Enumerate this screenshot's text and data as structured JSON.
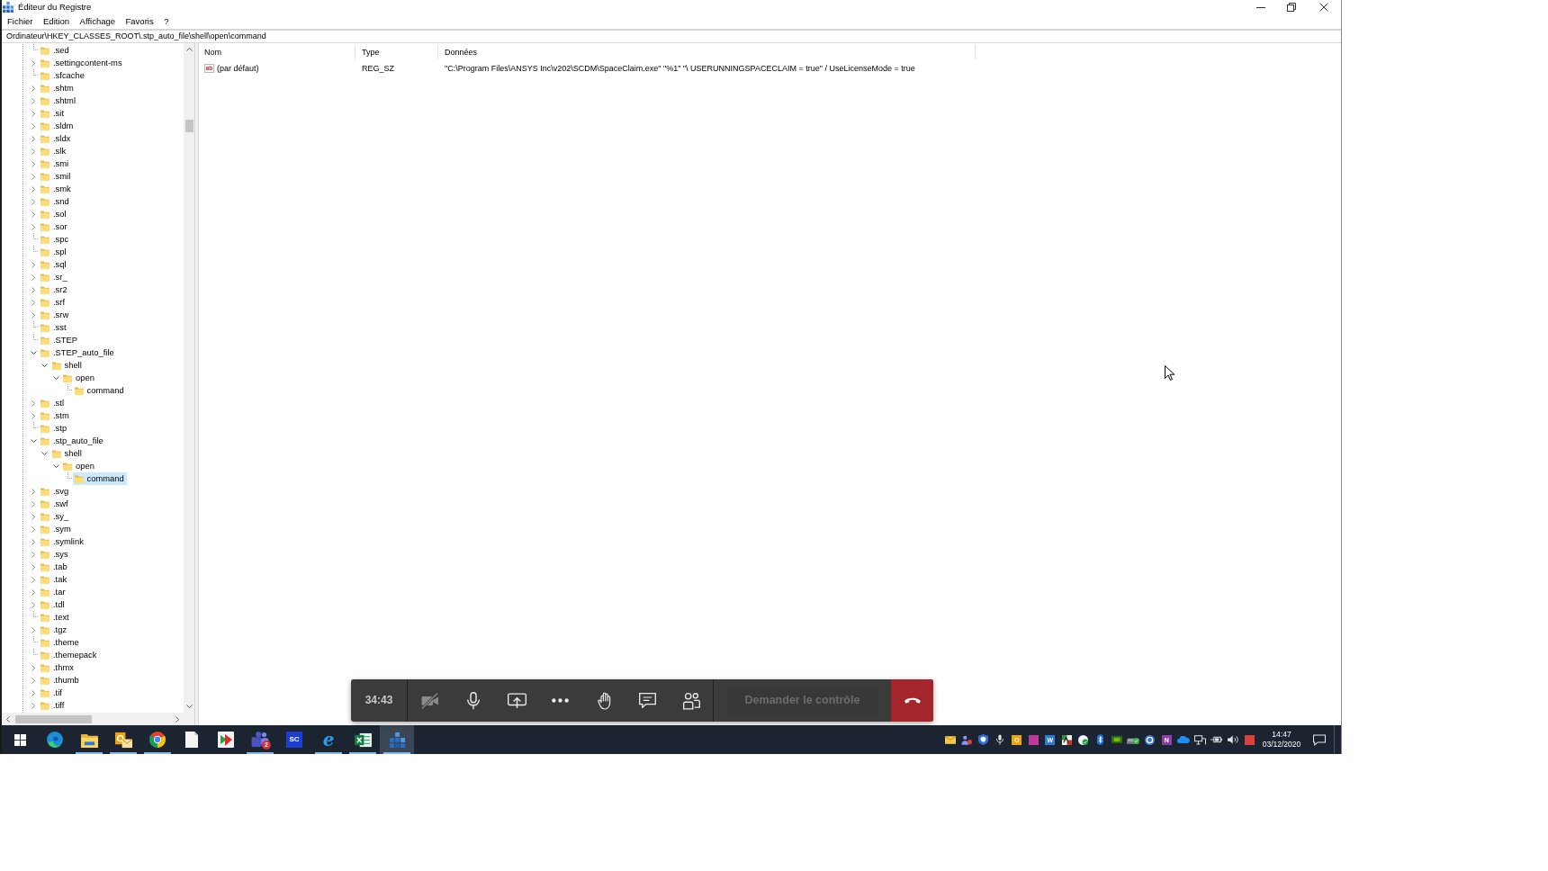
{
  "window": {
    "title": "Éditeur du Registre"
  },
  "menu": [
    "Fichier",
    "Edition",
    "Affichage",
    "Favoris",
    "?"
  ],
  "address_bar": {
    "value": "Ordinateur\\HKEY_CLASSES_ROOT\\.stp_auto_file\\shell\\open\\command"
  },
  "tree": {
    "items": [
      {
        "label": ".sed",
        "kind": "leaf",
        "expanded": false,
        "selected": false
      },
      {
        "label": ".settingcontent-ms",
        "kind": "branch",
        "expanded": false,
        "selected": false
      },
      {
        "label": ".sfcache",
        "kind": "leaf",
        "expanded": false,
        "selected": false
      },
      {
        "label": ".shtm",
        "kind": "branch",
        "expanded": false,
        "selected": false
      },
      {
        "label": ".shtml",
        "kind": "branch",
        "expanded": false,
        "selected": false
      },
      {
        "label": ".sit",
        "kind": "branch",
        "expanded": false,
        "selected": false
      },
      {
        "label": ".sldm",
        "kind": "branch",
        "expanded": false,
        "selected": false
      },
      {
        "label": ".sldx",
        "kind": "branch",
        "expanded": false,
        "selected": false
      },
      {
        "label": ".slk",
        "kind": "branch",
        "expanded": false,
        "selected": false
      },
      {
        "label": ".smi",
        "kind": "branch",
        "expanded": false,
        "selected": false
      },
      {
        "label": ".smil",
        "kind": "branch",
        "expanded": false,
        "selected": false
      },
      {
        "label": ".smk",
        "kind": "branch",
        "expanded": false,
        "selected": false
      },
      {
        "label": ".snd",
        "kind": "branch",
        "expanded": false,
        "selected": false
      },
      {
        "label": ".sol",
        "kind": "branch",
        "expanded": false,
        "selected": false
      },
      {
        "label": ".sor",
        "kind": "branch",
        "expanded": false,
        "selected": false
      },
      {
        "label": ".spc",
        "kind": "leaf",
        "expanded": false,
        "selected": false
      },
      {
        "label": ".spl",
        "kind": "leaf",
        "expanded": false,
        "selected": false
      },
      {
        "label": ".sql",
        "kind": "branch",
        "expanded": false,
        "selected": false
      },
      {
        "label": ".sr_",
        "kind": "branch",
        "expanded": false,
        "selected": false
      },
      {
        "label": ".sr2",
        "kind": "branch",
        "expanded": false,
        "selected": false
      },
      {
        "label": ".srf",
        "kind": "branch",
        "expanded": false,
        "selected": false
      },
      {
        "label": ".srw",
        "kind": "branch",
        "expanded": false,
        "selected": false
      },
      {
        "label": ".sst",
        "kind": "leaf",
        "expanded": false,
        "selected": false
      },
      {
        "label": ".STEP",
        "kind": "leaf",
        "expanded": false,
        "selected": false
      },
      {
        "label": ".STEP_auto_file",
        "kind": "branch",
        "expanded": true,
        "selected": false,
        "children": [
          {
            "label": "shell",
            "kind": "branch",
            "expanded": true,
            "selected": false,
            "children": [
              {
                "label": "open",
                "kind": "branch",
                "expanded": true,
                "selected": false,
                "children": [
                  {
                    "label": "command",
                    "kind": "leaf",
                    "expanded": false,
                    "selected": false
                  }
                ]
              }
            ]
          }
        ]
      },
      {
        "label": ".stl",
        "kind": "branch",
        "expanded": false,
        "selected": false
      },
      {
        "label": ".stm",
        "kind": "branch",
        "expanded": false,
        "selected": false
      },
      {
        "label": ".stp",
        "kind": "leaf",
        "expanded": false,
        "selected": false
      },
      {
        "label": ".stp_auto_file",
        "kind": "branch",
        "expanded": true,
        "selected": false,
        "children": [
          {
            "label": "shell",
            "kind": "branch",
            "expanded": true,
            "selected": false,
            "children": [
              {
                "label": "open",
                "kind": "branch",
                "expanded": true,
                "selected": false,
                "children": [
                  {
                    "label": "command",
                    "kind": "leaf",
                    "expanded": false,
                    "selected": true
                  }
                ]
              }
            ]
          }
        ]
      },
      {
        "label": ".svg",
        "kind": "branch",
        "expanded": false,
        "selected": false
      },
      {
        "label": ".swf",
        "kind": "branch",
        "expanded": false,
        "selected": false
      },
      {
        "label": ".sy_",
        "kind": "branch",
        "expanded": false,
        "selected": false
      },
      {
        "label": ".sym",
        "kind": "branch",
        "expanded": false,
        "selected": false
      },
      {
        "label": ".symlink",
        "kind": "branch",
        "expanded": false,
        "selected": false
      },
      {
        "label": ".sys",
        "kind": "branch",
        "expanded": false,
        "selected": false
      },
      {
        "label": ".tab",
        "kind": "branch",
        "expanded": false,
        "selected": false
      },
      {
        "label": ".tak",
        "kind": "branch",
        "expanded": false,
        "selected": false
      },
      {
        "label": ".tar",
        "kind": "branch",
        "expanded": false,
        "selected": false
      },
      {
        "label": ".tdl",
        "kind": "branch",
        "expanded": false,
        "selected": false
      },
      {
        "label": ".text",
        "kind": "leaf",
        "expanded": false,
        "selected": false
      },
      {
        "label": ".tgz",
        "kind": "branch",
        "expanded": false,
        "selected": false
      },
      {
        "label": ".theme",
        "kind": "leaf",
        "expanded": false,
        "selected": false
      },
      {
        "label": ".themepack",
        "kind": "leaf",
        "expanded": false,
        "selected": false
      },
      {
        "label": ".thmx",
        "kind": "branch",
        "expanded": false,
        "selected": false
      },
      {
        "label": ".thumb",
        "kind": "branch",
        "expanded": false,
        "selected": false
      },
      {
        "label": ".tif",
        "kind": "branch",
        "expanded": false,
        "selected": false
      },
      {
        "label": ".tiff",
        "kind": "branch",
        "expanded": false,
        "selected": false
      }
    ]
  },
  "values": {
    "columns": [
      "Nom",
      "Type",
      "Données"
    ],
    "rows": [
      {
        "icon_text": "ab",
        "name": "(par défaut)",
        "type": "REG_SZ",
        "data": "\"C:\\Program Files\\ANSYS Inc\\v202\\SCDM\\SpaceClaim.exe\" \"%1\" \"\\ USERUNNINGSPACECLAIM = true\" / UseLicenseMode = true"
      }
    ]
  },
  "call_bar": {
    "timer": "34:43",
    "camera_on": false,
    "mic_on": true,
    "request_control": {
      "label": "Demander le contrôle",
      "disabled": true
    }
  },
  "taskbar": {
    "apps": [
      {
        "kind": "swirl",
        "running": false,
        "selected": false
      },
      {
        "kind": "folder",
        "running": true,
        "selected": false
      },
      {
        "kind": "mail",
        "running": true,
        "selected": false
      },
      {
        "kind": "wheel",
        "running": true,
        "selected": false
      },
      {
        "kind": "page",
        "running": false,
        "selected": false
      },
      {
        "kind": "slide",
        "running": false,
        "selected": false
      },
      {
        "kind": "people",
        "badge": "2",
        "running": true,
        "selected": false
      },
      {
        "kind": "tile",
        "label": "SC",
        "running": false,
        "selected": false
      },
      {
        "kind": "letter",
        "label": "e",
        "running": true,
        "selected": false
      },
      {
        "kind": "sheet",
        "running": true,
        "selected": false
      },
      {
        "kind": "cubes",
        "running": true,
        "selected": true
      }
    ],
    "tray": [
      {
        "kind": "envelope"
      },
      {
        "kind": "people"
      },
      {
        "kind": "shield"
      },
      {
        "kind": "mic"
      },
      {
        "kind": "tile",
        "label": "O",
        "color": "#f4a30b"
      },
      {
        "kind": "tile",
        "color": "#c0399a"
      },
      {
        "kind": "tile",
        "label": "W",
        "color": "#2b7cd3"
      },
      {
        "kind": "checker"
      },
      {
        "kind": "guard"
      },
      {
        "kind": "bluetooth"
      },
      {
        "kind": "chip"
      },
      {
        "kind": "drive"
      },
      {
        "kind": "ring"
      },
      {
        "kind": "tile",
        "label": "N",
        "color": "#8e3ea8"
      },
      {
        "kind": "cloud"
      },
      {
        "kind": "network"
      },
      {
        "kind": "power"
      },
      {
        "kind": "speaker"
      },
      {
        "kind": "tile",
        "color": "#d9413c"
      }
    ],
    "clock": {
      "time": "14:47",
      "date": "03/12/2020"
    }
  }
}
